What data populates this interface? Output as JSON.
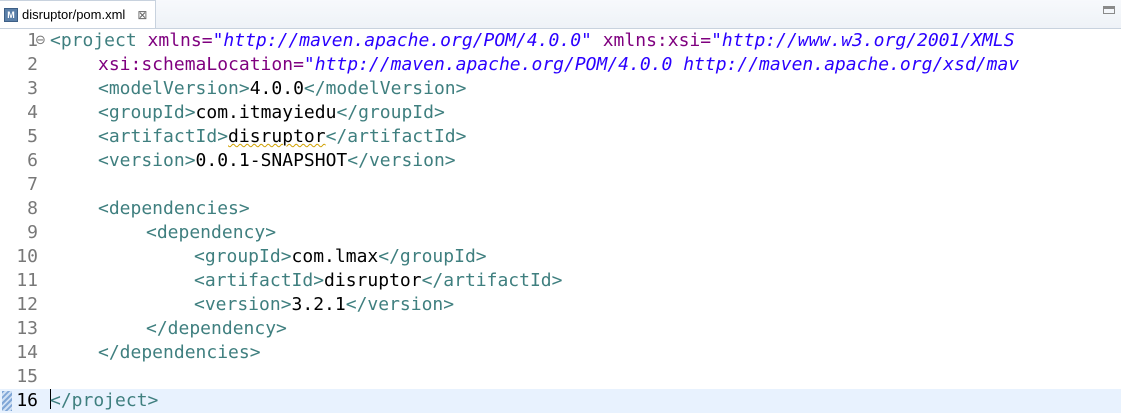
{
  "tab": {
    "icon": "M",
    "title": "disruptor/pom.xml",
    "close": "⊠"
  },
  "lines": [
    {
      "no": "1",
      "seg": [
        "<project",
        "xmlns=",
        "\"http://maven.apache.org/POM/4.0.0\"",
        "xmlns:xsi=",
        "\"http://www.w3.org/2001/XMLS"
      ]
    },
    {
      "no": "2",
      "seg": [
        "xsi:schemaLocation=",
        "\"http://maven.apache.org/POM/4.0.0 http://maven.apache.org/xsd/mav"
      ]
    },
    {
      "no": "3",
      "seg": [
        "<modelVersion>",
        "4.0.0",
        "</modelVersion>"
      ]
    },
    {
      "no": "4",
      "seg": [
        "<groupId>",
        "com.itmayiedu",
        "</groupId>"
      ]
    },
    {
      "no": "5",
      "seg": [
        "<artifactId>",
        "disruptor",
        "</artifactId>"
      ]
    },
    {
      "no": "6",
      "seg": [
        "<version>",
        "0.0.1-SNAPSHOT",
        "</version>"
      ]
    },
    {
      "no": "7",
      "seg": []
    },
    {
      "no": "8",
      "seg": [
        "<dependencies>"
      ]
    },
    {
      "no": "9",
      "seg": [
        "<dependency>"
      ]
    },
    {
      "no": "10",
      "seg": [
        "<groupId>",
        "com.lmax",
        "</groupId>"
      ]
    },
    {
      "no": "11",
      "seg": [
        "<artifactId>",
        "disruptor",
        "</artifactId>"
      ]
    },
    {
      "no": "12",
      "seg": [
        "<version>",
        "3.2.1",
        "</version>"
      ]
    },
    {
      "no": "13",
      "seg": [
        "</dependency>"
      ]
    },
    {
      "no": "14",
      "seg": [
        "</dependencies>"
      ]
    },
    {
      "no": "15",
      "seg": []
    },
    {
      "no": "16",
      "seg": [
        "</project>"
      ]
    }
  ],
  "fold_markers": {
    "line1": "⊖"
  },
  "colors": {
    "tag": "#3f7f7f",
    "attribute": "#7f007f",
    "value": "#2a00ff",
    "text": "#000000",
    "current_line": "#e8f2fe",
    "line_number": "#787878"
  }
}
